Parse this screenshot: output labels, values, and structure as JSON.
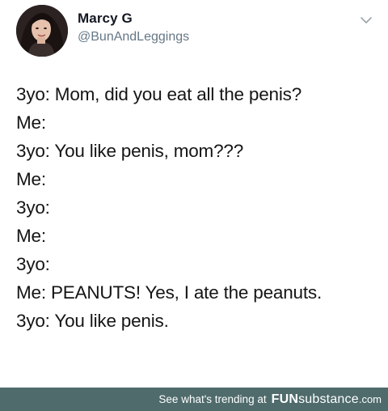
{
  "tweet": {
    "display_name": "Marcy G",
    "handle": "@BunAndLeggings",
    "menu_icon": "chevron-down-icon",
    "avatar_icon": "profile-photo",
    "lines": [
      "3yo: Mom, did you eat all the penis?",
      "Me:",
      "3yo: You like penis, mom???",
      "Me:",
      "3yo:",
      "Me:",
      "3yo:",
      "Me: PEANUTS! Yes, I ate the peanuts.",
      "3yo: You like penis."
    ]
  },
  "footer": {
    "text": "See what's trending at",
    "brand_bold": "FUN",
    "brand_rest": "substance",
    "domain": ".com",
    "background": "#4f6b6c"
  }
}
